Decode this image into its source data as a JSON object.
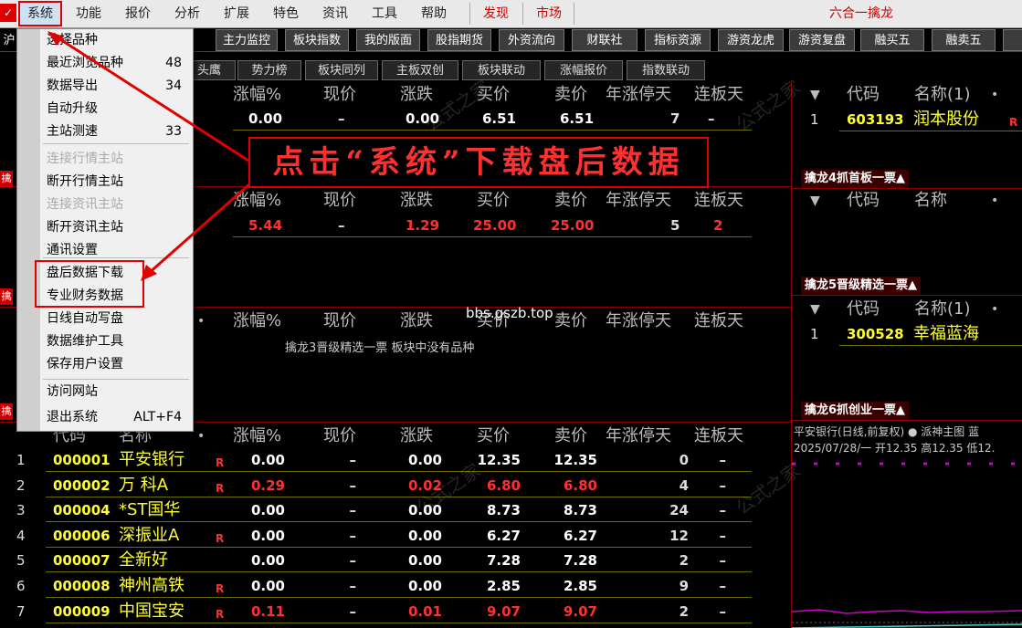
{
  "menubar": {
    "items": [
      "系统",
      "功能",
      "报价",
      "分析",
      "扩展",
      "特色",
      "资讯",
      "工具",
      "帮助"
    ],
    "red_items": [
      "发现",
      "市场"
    ],
    "title": "六合一擒龙"
  },
  "toolbar": {
    "left_cut": "沪",
    "buttons": [
      "主力监控",
      "板块指数",
      "我的版面",
      "股指期货",
      "外资流向",
      "财联社",
      "指标资源",
      "游资龙虎",
      "游资复盘",
      "融买五",
      "融卖五"
    ]
  },
  "tabs": [
    "头鹰",
    "势力榜",
    "板块同列",
    "主板双创",
    "板块联动",
    "涨幅报价",
    "指数联动"
  ],
  "columns": [
    "涨幅%",
    "现价",
    "涨跌",
    "买价",
    "卖价",
    "年涨停天",
    "连板天"
  ],
  "panel1": {
    "row": [
      "0.00",
      "–",
      "0.00",
      "6.51",
      "6.51",
      "7",
      "–"
    ]
  },
  "panel2": {
    "row": [
      "5.44",
      "–",
      "1.29",
      "25.00",
      "25.00",
      "5",
      "2"
    ]
  },
  "panel3": {
    "empty_msg": "擒龙3晋级精选一票 板块中没有品种",
    "watermark_url": "bbs.gszb.top"
  },
  "panel4": {
    "head": {
      "code": "代码",
      "name": "名称"
    },
    "rows": [
      {
        "idx": "1",
        "code": "000001",
        "name": "平安银行",
        "r": "R",
        "vals": [
          "0.00",
          "–",
          "0.00",
          "12.35",
          "12.35",
          "0",
          "–"
        ],
        "red": false
      },
      {
        "idx": "2",
        "code": "000002",
        "name": "万 科A",
        "r": "R",
        "vals": [
          "0.29",
          "–",
          "0.02",
          "6.80",
          "6.80",
          "4",
          "–"
        ],
        "red": true
      },
      {
        "idx": "3",
        "code": "000004",
        "name": "*ST国华",
        "r": "",
        "vals": [
          "0.00",
          "–",
          "0.00",
          "8.73",
          "8.73",
          "24",
          "–"
        ],
        "red": false
      },
      {
        "idx": "4",
        "code": "000006",
        "name": "深振业A",
        "r": "R",
        "vals": [
          "0.00",
          "–",
          "0.00",
          "6.27",
          "6.27",
          "12",
          "–"
        ],
        "red": false
      },
      {
        "idx": "5",
        "code": "000007",
        "name": "全新好",
        "r": "",
        "vals": [
          "0.00",
          "–",
          "0.00",
          "7.28",
          "7.28",
          "2",
          "–"
        ],
        "red": false
      },
      {
        "idx": "6",
        "code": "000008",
        "name": "神州高铁",
        "r": "R",
        "vals": [
          "0.00",
          "–",
          "0.00",
          "2.85",
          "2.85",
          "9",
          "–"
        ],
        "red": false
      },
      {
        "idx": "7",
        "code": "000009",
        "name": "中国宝安",
        "r": "R",
        "vals": [
          "0.11",
          "–",
          "0.01",
          "9.07",
          "9.07",
          "2",
          "–"
        ],
        "red": true
      }
    ]
  },
  "right": {
    "head1": {
      "code": "代码",
      "name": "名称(1)"
    },
    "row1": {
      "idx": "1",
      "code": "603193",
      "name": "润本股份",
      "r": "R"
    },
    "badge4": "擒龙4抓首板一票▲",
    "head2": {
      "code": "代码",
      "name": "名称"
    },
    "badge5": "擒龙5晋级精选一票▲",
    "head3": {
      "code": "代码",
      "name": "名称(1)"
    },
    "row3": {
      "idx": "1",
      "code": "300528",
      "name": "幸福蓝海"
    },
    "badge6": "擒龙6抓创业一票▲",
    "chart_title": "平安银行(日线,前复权) ● 派神主图 蓝",
    "chart_info": "2025/07/28/一 开12.35 高12.35 低12."
  },
  "dropdown": {
    "items": [
      {
        "label": "选择品种",
        "kb": "",
        "dis": false
      },
      {
        "label": "最近浏览品种",
        "kb": "48",
        "dis": false
      },
      {
        "label": "数据导出",
        "kb": "34",
        "dis": false
      },
      {
        "label": "自动升级",
        "kb": "",
        "dis": false
      },
      {
        "label": "主站测速",
        "kb": "33",
        "dis": false
      },
      {
        "label": "连接行情主站",
        "kb": "",
        "dis": true
      },
      {
        "label": "断开行情主站",
        "kb": "",
        "dis": false
      },
      {
        "label": "连接资讯主站",
        "kb": "",
        "dis": true
      },
      {
        "label": "断开资讯主站",
        "kb": "",
        "dis": false
      },
      {
        "label": "通讯设置",
        "kb": "",
        "dis": false
      },
      {
        "label": "盘后数据下载",
        "kb": "",
        "dis": false
      },
      {
        "label": "专业财务数据",
        "kb": "",
        "dis": false
      },
      {
        "label": "日线自动写盘",
        "kb": "",
        "dis": false
      },
      {
        "label": "数据维护工具",
        "kb": "",
        "dis": false
      },
      {
        "label": "保存用户设置",
        "kb": "",
        "dis": false
      },
      {
        "label": "访问网站",
        "kb": "",
        "dis": false
      },
      {
        "label": "退出系统",
        "kb": "ALT+F4",
        "dis": false
      }
    ]
  },
  "callout": "点击“系统”下载盘后数据",
  "colors": {
    "red": "#ff3030",
    "yellow": "#ffff30",
    "gray": "#bbbbbb",
    "accent": "#e00000"
  }
}
